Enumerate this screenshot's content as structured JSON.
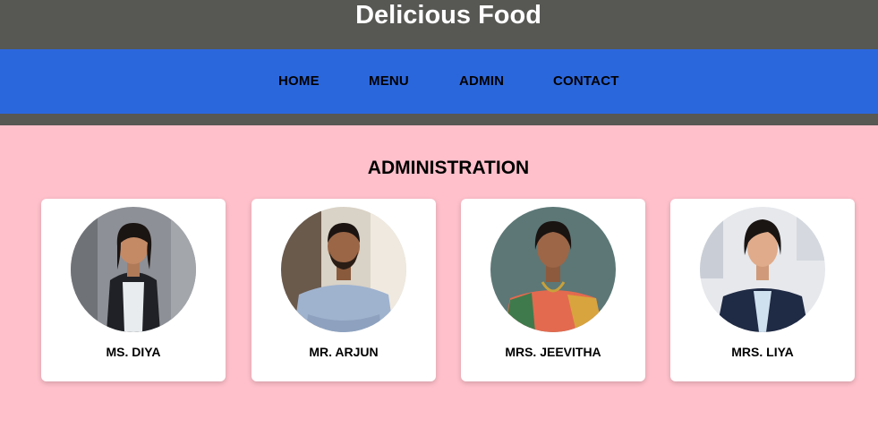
{
  "header": {
    "title": "Delicious Food"
  },
  "nav": {
    "items": [
      {
        "label": "HOME"
      },
      {
        "label": "MENU"
      },
      {
        "label": "ADMIN"
      },
      {
        "label": "CONTACT"
      }
    ]
  },
  "admin": {
    "title": "ADMINISTRATION",
    "members": [
      {
        "name": "MS. DIYA",
        "photo": "woman-in-black-blazer-photo"
      },
      {
        "name": "MR. ARJUN",
        "photo": "man-in-blue-shirt-photo"
      },
      {
        "name": "MRS. JEEVITHA",
        "photo": "woman-in-saree-photo"
      },
      {
        "name": "MRS. LIYA",
        "photo": "woman-in-navy-suit-photo"
      }
    ]
  },
  "colors": {
    "page_background": "#ffc0cb",
    "header_background": "#575754",
    "nav_background": "#2b67dc",
    "card_background": "#ffffff"
  }
}
